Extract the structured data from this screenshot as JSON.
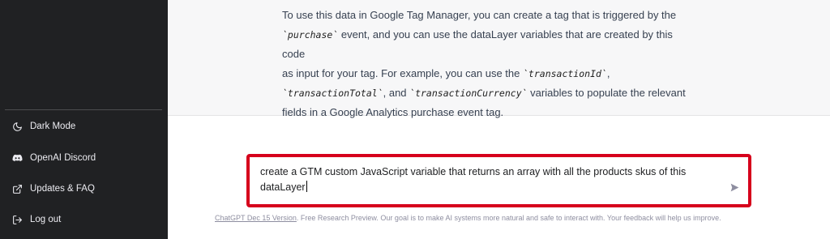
{
  "sidebar": {
    "items": [
      {
        "label": "Dark Mode",
        "icon": "moon-icon"
      },
      {
        "label": "OpenAI Discord",
        "icon": "discord-icon"
      },
      {
        "label": "Updates & FAQ",
        "icon": "external-link-icon"
      },
      {
        "label": "Log out",
        "icon": "logout-icon"
      }
    ]
  },
  "response": {
    "line1": "To use this data in Google Tag Manager, you can create a tag that is triggered by the",
    "line2_code": "`purchase`",
    "line2_rest": " event, and you can use the dataLayer variables that are created by this code",
    "line3_a": "as input for your tag. For example, you can use the ",
    "line3_code": "`transactionId`",
    "line3_b": ",",
    "line4_code1": "`transactionTotal`",
    "line4_a": ", and ",
    "line4_code2": "`transactionCurrency`",
    "line4_b": " variables to populate the relevant",
    "line5": "fields in a Google Analytics purchase event tag."
  },
  "input": {
    "value_line1": "create a GTM custom JavaScript variable that returns an array with all the products skus of this",
    "value_line2": "dataLayer"
  },
  "footer": {
    "version_link": "ChatGPT Dec 15 Version",
    "text": ". Free Research Preview. Our goal is to make AI systems more natural and safe to interact with. Your feedback will help us improve."
  },
  "colors": {
    "sidebar_bg": "#202123",
    "highlight_border": "#d6001c",
    "response_bg": "#f7f7f8"
  }
}
